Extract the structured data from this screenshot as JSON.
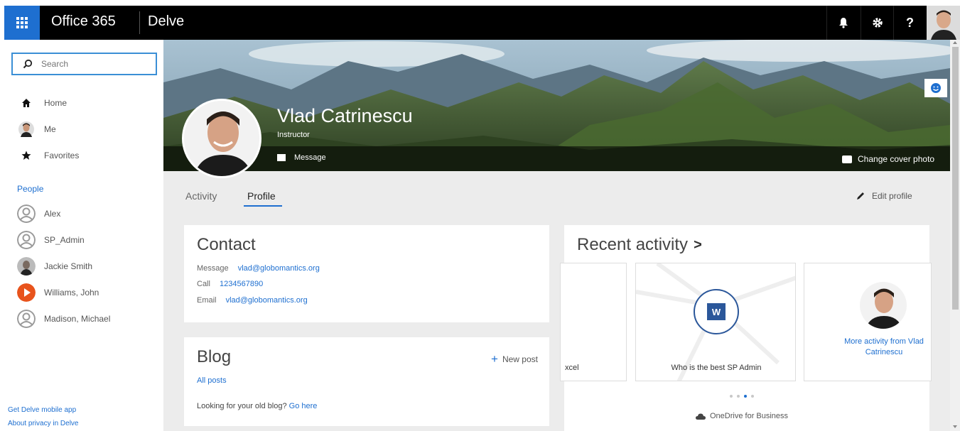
{
  "topbar": {
    "brand": "Office 365",
    "app_name": "Delve",
    "icons": [
      "bell-icon",
      "gear-icon",
      "help-icon"
    ],
    "help_glyph": "?"
  },
  "leftnav": {
    "search_placeholder": "Search",
    "items": [
      {
        "label": "Home",
        "icon": "home-icon"
      },
      {
        "label": "Me",
        "icon": "avatar"
      },
      {
        "label": "Favorites",
        "icon": "star-icon"
      }
    ],
    "people_header": "People",
    "people": [
      {
        "name": "Alex",
        "avatar": "generic"
      },
      {
        "name": "SP_Admin",
        "avatar": "generic"
      },
      {
        "name": "Jackie Smith",
        "avatar": "photo"
      },
      {
        "name": "Williams, John",
        "avatar": "play-orange"
      },
      {
        "name": "Madison, Michael",
        "avatar": "generic"
      }
    ],
    "footer_links": [
      "Get Delve mobile app",
      "About privacy in Delve"
    ]
  },
  "profile": {
    "name": "Vlad Catrinescu",
    "title": "Instructor",
    "message_label": "Message",
    "change_cover_label": "Change cover photo"
  },
  "tabs": [
    {
      "label": "Activity",
      "active": false
    },
    {
      "label": "Profile",
      "active": true
    }
  ],
  "edit_profile_label": "Edit profile",
  "contact": {
    "title": "Contact",
    "rows": [
      {
        "label": "Message",
        "value": "vlad@globomantics.org"
      },
      {
        "label": "Call",
        "value": "1234567890"
      },
      {
        "label": "Email",
        "value": "vlad@globomantics.org"
      }
    ]
  },
  "blog": {
    "title": "Blog",
    "new_post_label": "New post",
    "all_posts_label": "All posts",
    "old_blog_text": "Looking for your old blog?",
    "go_here_label": "Go here"
  },
  "recent_activity": {
    "title": "Recent activity",
    "chevron": ">",
    "partial_card_text": "xcel",
    "doc_card_title": "Who is the best SP Admin",
    "doc_app_letter": "W",
    "more_activity_label": "More activity from Vlad Catrinescu",
    "source_label": "OneDrive for Business",
    "page_dots": 4,
    "active_dot": 2
  },
  "colors": {
    "accent": "#1e6fd0",
    "topbar_bg": "#000000",
    "word_blue": "#2b579a"
  }
}
